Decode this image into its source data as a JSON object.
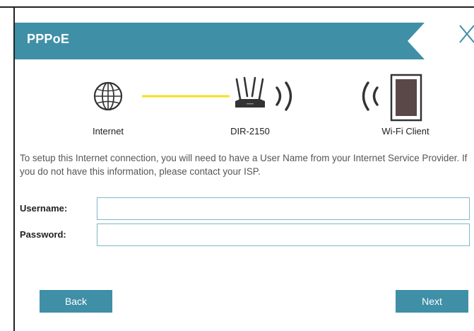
{
  "dialog": {
    "title": "PPPoE",
    "accent_color": "#3f8fa7"
  },
  "diagram": {
    "internet_label": "Internet",
    "router_label": "DIR-2150",
    "client_label": "Wi-Fi Client",
    "link_color": "#f7e11b"
  },
  "description": "To setup this Internet connection, you will need to have a User Name from your Internet Service Provider. If you do not have this information, please contact your ISP.",
  "form": {
    "username_label": "Username:",
    "username_value": "",
    "password_label": "Password:",
    "password_value": ""
  },
  "buttons": {
    "back": "Back",
    "next": "Next"
  }
}
